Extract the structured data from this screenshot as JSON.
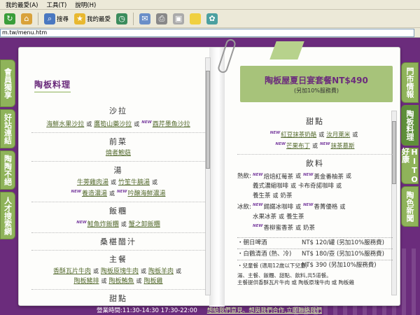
{
  "browser": {
    "menu": [
      "我的最愛(A)",
      "工具(T)",
      "說明(H)"
    ],
    "toolbar": {
      "search": "搜尋",
      "favorites": "我的最愛"
    },
    "address": "m.tw/menu.htm"
  },
  "left_tabs": [
    "會員獨享",
    "好站連結",
    "陶陶不絕",
    "人才搜索網"
  ],
  "right_tabs": [
    "門市情報",
    "陶板料理",
    "HITO好康",
    "陶色新聞"
  ],
  "left_page": {
    "title": "陶板料理",
    "or": "或",
    "new": "NEW",
    "sections": {
      "salad": "沙拉",
      "salad_items": [
        "海鮮水果沙拉",
        "鷹筍山藥沙拉",
        "酉芹墨魚沙拉"
      ],
      "appetizer": "前菜",
      "appetizer_items": [
        "燒者鮑菇"
      ],
      "soup": "湯",
      "soup_items": [
        "牛蒡雞肉湯",
        "竹笙牛腩湯",
        "養造濃湯",
        "吟醸海鮮濃湯"
      ],
      "rice": "飯糰",
      "rice_items": [
        "鮭魚炸飯糰",
        "蟹之卸飯糰"
      ],
      "vinegar": "桑椹醋汁",
      "main": "主餐",
      "main_items": [
        "香酥瓦片牛肉",
        "陶板原塊牛肉",
        "陶板羊肉",
        "陶板豬排",
        "陶板鮪魚",
        "陶板雞"
      ],
      "dessert": "甜點"
    }
  },
  "right_page": {
    "banner_title": "陶板屋夏日宴套餐NT$490",
    "banner_sub": "(另加10%服務費)",
    "dessert": "甜點",
    "dessert_items": [
      "紅豆抹茶奶酪",
      "汝月萊米",
      "芒果布丁",
      "抹茶慕斯"
    ],
    "drinks": "飲料",
    "hot": "熱飲:",
    "cold": "冰飲:",
    "hot_items": [
      "焙焙紅莓茶",
      "黃金番柚茶",
      "義式濃縮咖啡",
      "卡布奇諾咖啡",
      "養生茶",
      "奶茶"
    ],
    "cold_items": [
      "錫鐵冰咖啡",
      "香菁優格",
      "水果冰茶",
      "養生茶",
      "香柳蜜香茶",
      "奶茶"
    ],
    "draft_label": "・朝日啤酒",
    "draft_price": "NT$ 120/罐 (另加10%服務費)",
    "sake_label": "・白鶴清酒 (熱、冷)",
    "sake_price": "NT$ 180/壺 (另加10%服務費)",
    "kids_label": "・兒童餐 (適用12歲以下兒童)",
    "kids_price": "NT$ 390 (另加10%服務費)",
    "kids_note1": "湯、主餐、飯糰、甜點、飲料,共5道餐。",
    "kids_note2": "主餐提供香酥瓦片牛肉 或 陶板原塊牛肉 或 陶板雞"
  },
  "footer": {
    "hours": "營業時間:11:30-14:30  17:30-22:00",
    "link": "想給我們意見、想與我們合作,立即聯絡我們"
  }
}
